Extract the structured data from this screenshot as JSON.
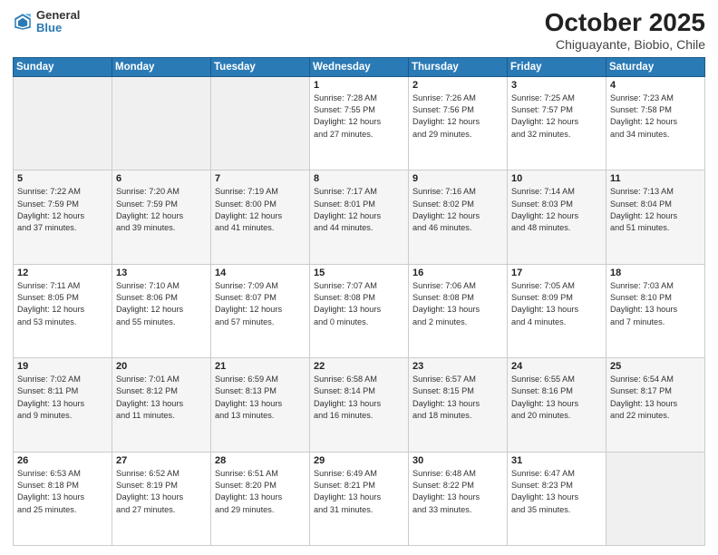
{
  "header": {
    "logo_line1": "General",
    "logo_line2": "Blue",
    "title": "October 2025",
    "subtitle": "Chiguayante, Biobio, Chile"
  },
  "days_of_week": [
    "Sunday",
    "Monday",
    "Tuesday",
    "Wednesday",
    "Thursday",
    "Friday",
    "Saturday"
  ],
  "weeks": [
    [
      {
        "day": "",
        "info": ""
      },
      {
        "day": "",
        "info": ""
      },
      {
        "day": "",
        "info": ""
      },
      {
        "day": "1",
        "info": "Sunrise: 7:28 AM\nSunset: 7:55 PM\nDaylight: 12 hours\nand 27 minutes."
      },
      {
        "day": "2",
        "info": "Sunrise: 7:26 AM\nSunset: 7:56 PM\nDaylight: 12 hours\nand 29 minutes."
      },
      {
        "day": "3",
        "info": "Sunrise: 7:25 AM\nSunset: 7:57 PM\nDaylight: 12 hours\nand 32 minutes."
      },
      {
        "day": "4",
        "info": "Sunrise: 7:23 AM\nSunset: 7:58 PM\nDaylight: 12 hours\nand 34 minutes."
      }
    ],
    [
      {
        "day": "5",
        "info": "Sunrise: 7:22 AM\nSunset: 7:59 PM\nDaylight: 12 hours\nand 37 minutes."
      },
      {
        "day": "6",
        "info": "Sunrise: 7:20 AM\nSunset: 7:59 PM\nDaylight: 12 hours\nand 39 minutes."
      },
      {
        "day": "7",
        "info": "Sunrise: 7:19 AM\nSunset: 8:00 PM\nDaylight: 12 hours\nand 41 minutes."
      },
      {
        "day": "8",
        "info": "Sunrise: 7:17 AM\nSunset: 8:01 PM\nDaylight: 12 hours\nand 44 minutes."
      },
      {
        "day": "9",
        "info": "Sunrise: 7:16 AM\nSunset: 8:02 PM\nDaylight: 12 hours\nand 46 minutes."
      },
      {
        "day": "10",
        "info": "Sunrise: 7:14 AM\nSunset: 8:03 PM\nDaylight: 12 hours\nand 48 minutes."
      },
      {
        "day": "11",
        "info": "Sunrise: 7:13 AM\nSunset: 8:04 PM\nDaylight: 12 hours\nand 51 minutes."
      }
    ],
    [
      {
        "day": "12",
        "info": "Sunrise: 7:11 AM\nSunset: 8:05 PM\nDaylight: 12 hours\nand 53 minutes."
      },
      {
        "day": "13",
        "info": "Sunrise: 7:10 AM\nSunset: 8:06 PM\nDaylight: 12 hours\nand 55 minutes."
      },
      {
        "day": "14",
        "info": "Sunrise: 7:09 AM\nSunset: 8:07 PM\nDaylight: 12 hours\nand 57 minutes."
      },
      {
        "day": "15",
        "info": "Sunrise: 7:07 AM\nSunset: 8:08 PM\nDaylight: 13 hours\nand 0 minutes."
      },
      {
        "day": "16",
        "info": "Sunrise: 7:06 AM\nSunset: 8:08 PM\nDaylight: 13 hours\nand 2 minutes."
      },
      {
        "day": "17",
        "info": "Sunrise: 7:05 AM\nSunset: 8:09 PM\nDaylight: 13 hours\nand 4 minutes."
      },
      {
        "day": "18",
        "info": "Sunrise: 7:03 AM\nSunset: 8:10 PM\nDaylight: 13 hours\nand 7 minutes."
      }
    ],
    [
      {
        "day": "19",
        "info": "Sunrise: 7:02 AM\nSunset: 8:11 PM\nDaylight: 13 hours\nand 9 minutes."
      },
      {
        "day": "20",
        "info": "Sunrise: 7:01 AM\nSunset: 8:12 PM\nDaylight: 13 hours\nand 11 minutes."
      },
      {
        "day": "21",
        "info": "Sunrise: 6:59 AM\nSunset: 8:13 PM\nDaylight: 13 hours\nand 13 minutes."
      },
      {
        "day": "22",
        "info": "Sunrise: 6:58 AM\nSunset: 8:14 PM\nDaylight: 13 hours\nand 16 minutes."
      },
      {
        "day": "23",
        "info": "Sunrise: 6:57 AM\nSunset: 8:15 PM\nDaylight: 13 hours\nand 18 minutes."
      },
      {
        "day": "24",
        "info": "Sunrise: 6:55 AM\nSunset: 8:16 PM\nDaylight: 13 hours\nand 20 minutes."
      },
      {
        "day": "25",
        "info": "Sunrise: 6:54 AM\nSunset: 8:17 PM\nDaylight: 13 hours\nand 22 minutes."
      }
    ],
    [
      {
        "day": "26",
        "info": "Sunrise: 6:53 AM\nSunset: 8:18 PM\nDaylight: 13 hours\nand 25 minutes."
      },
      {
        "day": "27",
        "info": "Sunrise: 6:52 AM\nSunset: 8:19 PM\nDaylight: 13 hours\nand 27 minutes."
      },
      {
        "day": "28",
        "info": "Sunrise: 6:51 AM\nSunset: 8:20 PM\nDaylight: 13 hours\nand 29 minutes."
      },
      {
        "day": "29",
        "info": "Sunrise: 6:49 AM\nSunset: 8:21 PM\nDaylight: 13 hours\nand 31 minutes."
      },
      {
        "day": "30",
        "info": "Sunrise: 6:48 AM\nSunset: 8:22 PM\nDaylight: 13 hours\nand 33 minutes."
      },
      {
        "day": "31",
        "info": "Sunrise: 6:47 AM\nSunset: 8:23 PM\nDaylight: 13 hours\nand 35 minutes."
      },
      {
        "day": "",
        "info": ""
      }
    ]
  ]
}
